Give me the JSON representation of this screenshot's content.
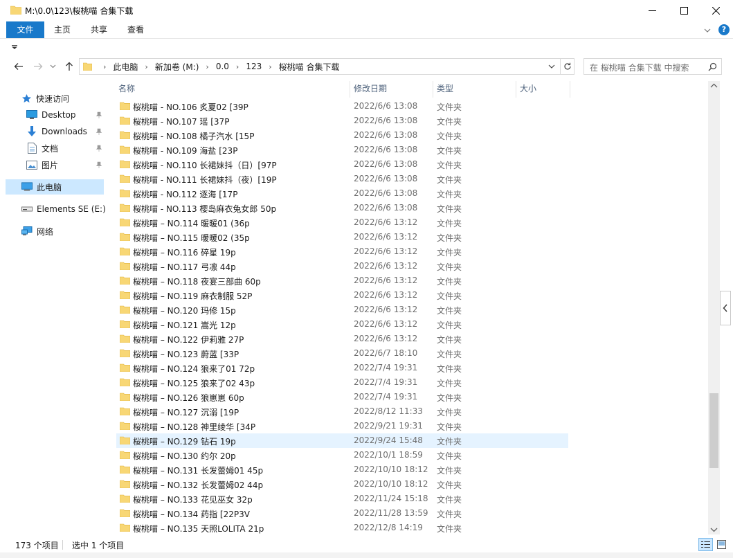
{
  "window": {
    "title": "M:\\0.0\\123\\桜桃喵 合集下载"
  },
  "ribbon": {
    "tabs": [
      {
        "label": "文件"
      },
      {
        "label": "主页"
      },
      {
        "label": "共享"
      },
      {
        "label": "查看"
      }
    ]
  },
  "address": {
    "crumbs": [
      "此电脑",
      "新加卷 (M:)",
      "0.0",
      "123",
      "桜桃喵 合集下载"
    ]
  },
  "search": {
    "placeholder": "在 桜桃喵 合集下载 中搜索"
  },
  "navpane": {
    "quick_access": "快速访问",
    "items": [
      {
        "label": "Desktop",
        "icon": "desktop-icon",
        "pinned": true
      },
      {
        "label": "Downloads",
        "icon": "download-icon",
        "pinned": true
      },
      {
        "label": "文档",
        "icon": "document-icon",
        "pinned": true
      },
      {
        "label": "图片",
        "icon": "picture-icon",
        "pinned": true
      }
    ],
    "this_pc": "此电脑",
    "drive": "Elements SE (E:)",
    "network": "网络"
  },
  "columns": {
    "name": "名称",
    "date": "修改日期",
    "type": "类型",
    "size": "大小"
  },
  "files": [
    {
      "name": "桜桃喵 - NO.106 炙夏02 [39P",
      "date": "2022/6/6 13:08",
      "type": "文件夹"
    },
    {
      "name": "桜桃喵 - NO.107 瑶 [37P",
      "date": "2022/6/6 13:08",
      "type": "文件夹"
    },
    {
      "name": "桜桃喵 - NO.108 橘子汽水 [15P",
      "date": "2022/6/6 13:08",
      "type": "文件夹"
    },
    {
      "name": "桜桃喵 - NO.109 海盐 [23P",
      "date": "2022/6/6 13:08",
      "type": "文件夹"
    },
    {
      "name": "桜桃喵 - NO.110 长裙妹抖（日）[97P",
      "date": "2022/6/6 13:08",
      "type": "文件夹"
    },
    {
      "name": "桜桃喵 - NO.111 长裙妹抖（夜）[19P",
      "date": "2022/6/6 13:08",
      "type": "文件夹"
    },
    {
      "name": "桜桃喵 - NO.112 逐海 [17P",
      "date": "2022/6/6 13:08",
      "type": "文件夹"
    },
    {
      "name": "桜桃喵 - NO.113 樱岛麻衣兔女郎 50p",
      "date": "2022/6/6 13:08",
      "type": "文件夹"
    },
    {
      "name": "桜桃喵 – NO.114 暖暖01 (36p",
      "date": "2022/6/6 13:12",
      "type": "文件夹"
    },
    {
      "name": "桜桃喵 – NO.115 暖暖02 (35p",
      "date": "2022/6/6 13:12",
      "type": "文件夹"
    },
    {
      "name": "桜桃喵 – NO.116 碎星 19p",
      "date": "2022/6/6 13:12",
      "type": "文件夹"
    },
    {
      "name": "桜桃喵 – NO.117 弓凛 44p",
      "date": "2022/6/6 13:12",
      "type": "文件夹"
    },
    {
      "name": "桜桃喵 – NO.118  夜宴三部曲 60p",
      "date": "2022/6/6 13:12",
      "type": "文件夹"
    },
    {
      "name": "桜桃喵 – NO.119 麻衣制服 52P",
      "date": "2022/6/6 13:12",
      "type": "文件夹"
    },
    {
      "name": "桜桃喵 – NO.120 玛修 15p",
      "date": "2022/6/6 13:12",
      "type": "文件夹"
    },
    {
      "name": "桜桃喵 – NO.121 嵩光 12p",
      "date": "2022/6/6 13:12",
      "type": "文件夹"
    },
    {
      "name": "桜桃喵 – NO.122 伊莉雅 27P",
      "date": "2022/6/6 13:12",
      "type": "文件夹"
    },
    {
      "name": "桜桃喵 – NO.123 蔚蓝 [33P",
      "date": "2022/6/7 18:10",
      "type": "文件夹"
    },
    {
      "name": "桜桃喵 – NO.124 狼来了01 72p",
      "date": "2022/7/4 19:31",
      "type": "文件夹"
    },
    {
      "name": "桜桃喵 – NO.125 狼来了02 43p",
      "date": "2022/7/4 19:31",
      "type": "文件夹"
    },
    {
      "name": "桜桃喵 – NO.126 狼崽崽 60p",
      "date": "2022/7/4 19:31",
      "type": "文件夹"
    },
    {
      "name": "桜桃喵 – NO.127 沉溺 [19P",
      "date": "2022/8/12 11:33",
      "type": "文件夹"
    },
    {
      "name": "桜桃喵 – NO.128 神里绫华 [34P",
      "date": "2022/9/21 19:31",
      "type": "文件夹"
    },
    {
      "name": "桜桃喵 – NO.129 钻石 19p",
      "date": "2022/9/24 15:48",
      "type": "文件夹"
    },
    {
      "name": "桜桃喵 – NO.130 约尔 20p",
      "date": "2022/10/1 18:59",
      "type": "文件夹"
    },
    {
      "name": "桜桃喵 – NO.131 长发蕾姆01 45p",
      "date": "2022/10/10 18:12",
      "type": "文件夹"
    },
    {
      "name": "桜桃喵 – NO.132 长发蕾姆02 44p",
      "date": "2022/10/10 18:12",
      "type": "文件夹"
    },
    {
      "name": "桜桃喵 – NO.133 花见巫女 32p",
      "date": "2022/11/24 15:18",
      "type": "文件夹"
    },
    {
      "name": "桜桃喵 – NO.134 药指 [22P3V",
      "date": "2022/11/28 13:59",
      "type": "文件夹"
    },
    {
      "name": "桜桃喵 – NO.135 天照LOLITA 21p",
      "date": "2022/12/8 14:19",
      "type": "文件夹"
    }
  ],
  "highlighted_index": 23,
  "status": {
    "count": "173 个项目",
    "selected": "选中 1 个项目"
  },
  "colors": {
    "accent": "#1979ca",
    "folder": "#f8d775",
    "selection": "#e5f3ff"
  }
}
